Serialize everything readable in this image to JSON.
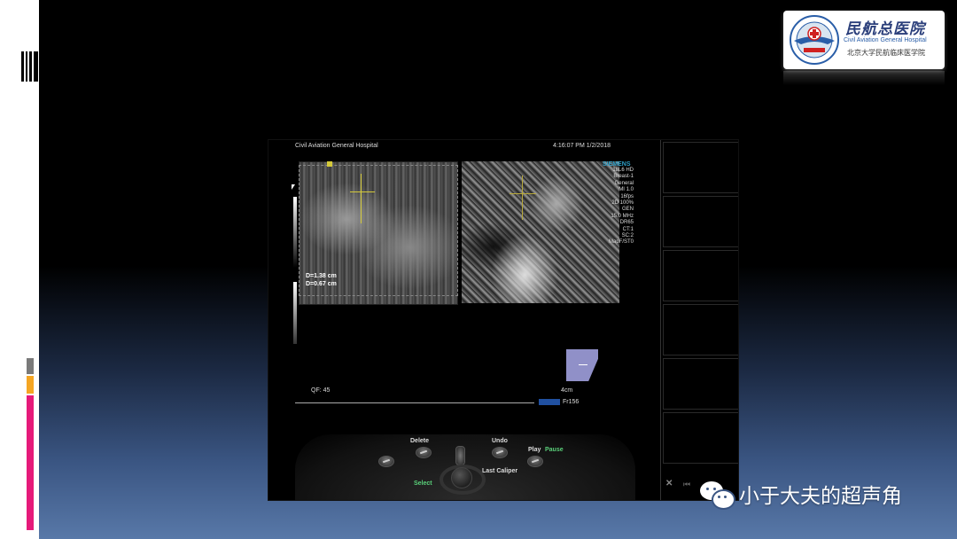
{
  "logo": {
    "zh_name": "民航总医院",
    "en_name": "Civil Aviation General Hospital",
    "zh_sub": "北京大学民航临床医学院"
  },
  "ultrasound": {
    "institution": "Civil Aviation General Hospital",
    "datetime": "4:16:07 PM 1/2/2018",
    "brand": "SIEMENS",
    "params": [
      "18L6 HD",
      "Breast-1",
      "General",
      "MI 1.0",
      "16fps",
      "2D 100%",
      "GEN",
      "15.0 MHz",
      "DR65",
      "CT:1",
      "SC:2",
      "MapF/ST0"
    ],
    "measurements": [
      "D=1.38 cm",
      "D=0.67 cm"
    ],
    "qf": "QF: 45",
    "depth": "4cm",
    "frame": "Fr156",
    "controls": {
      "delete": "Delete",
      "undo": "Undo",
      "play": "Play",
      "pause": "Pause",
      "last_caliper": "Last Caliper",
      "select": "Select"
    }
  },
  "watermark": {
    "text": "小于大夫的超声角"
  },
  "colors": {
    "accent_pink": "#e61a7a",
    "accent_orange": "#f5a623",
    "accent_gray": "#7a7a7a",
    "caliper_yellow": "#d4c93a",
    "siemens_blue": "#2fa0c8",
    "pause_green": "#5ad07a"
  },
  "icons": [
    "bars-icon",
    "hospital-emblem-icon",
    "wechat-icon",
    "close-icon",
    "skip-icon",
    "body-marker-icon"
  ]
}
